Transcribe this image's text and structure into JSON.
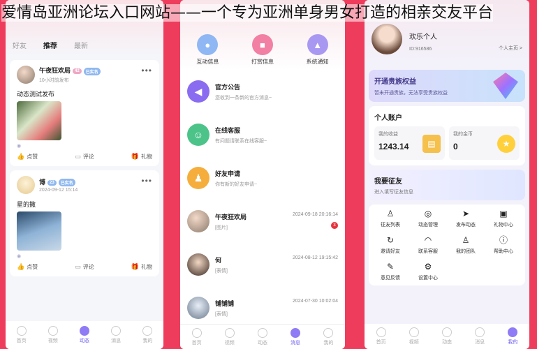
{
  "overlay": {
    "title": "爱情岛亚洲论坛入口网站——一个专为亚洲单身男女打造的相亲交友平台"
  },
  "feed": {
    "tabs": [
      "好友",
      "推荐",
      "最新"
    ],
    "posts": [
      {
        "name": "午夜狂欢局",
        "badge_level": "42",
        "badge_tag": "已实名",
        "time": "10小时前发布",
        "text": "动态测试发布",
        "actions": [
          "点赞",
          "评论",
          "礼物"
        ]
      },
      {
        "name": "博",
        "badge_level": "23",
        "badge_tag": "已实名",
        "time": "2024-09-12 15:14",
        "text": "星的撒",
        "actions": [
          "点赞",
          "评论",
          "礼物"
        ]
      }
    ],
    "nav": [
      "首页",
      "视频",
      "动态",
      "消息",
      "我的"
    ]
  },
  "messages": {
    "top_icons": [
      "互动信息",
      "打赏信息",
      "系统通知"
    ],
    "system": [
      {
        "title": "官方公告",
        "sub": "您收到一条新的官方消息~"
      },
      {
        "title": "在线客服",
        "sub": "有问题请联系在线客服~"
      },
      {
        "title": "好友申请",
        "sub": "你有新的好友申请~"
      }
    ],
    "chats": [
      {
        "title": "午夜狂欢局",
        "sub": "[图片]",
        "time": "2024-09-18 20:16:14",
        "unread": "3"
      },
      {
        "title": "何",
        "sub": "[表情]",
        "time": "2024-08-12 19:15:42"
      },
      {
        "title": "铺铺铺",
        "sub": "[表情]",
        "time": "2024-07-30 10:02:04"
      }
    ],
    "nav": [
      "首页",
      "视频",
      "动态",
      "消息",
      "我的"
    ]
  },
  "profile": {
    "name": "欢乐个人",
    "id": "ID:916586",
    "link": "个人主页 >",
    "vip_title": "开通贵族权益",
    "vip_sub": "暂未开通贵族，无法享受贵族权益",
    "account_title": "个人账户",
    "income_label": "我的收益",
    "income_value": "1243.14",
    "coins_label": "我的金币",
    "coins_value": "0",
    "friend_title": "我要征友",
    "friend_sub": "进入填写征友信息",
    "grid": [
      "征友列表",
      "动态管理",
      "发布动态",
      "礼物中心",
      "邀请好友",
      "联系客服",
      "我的团队",
      "帮助中心",
      "意见反馈",
      "设置中心"
    ],
    "nav": [
      "首页",
      "视频",
      "动态",
      "消息",
      "我的"
    ]
  }
}
